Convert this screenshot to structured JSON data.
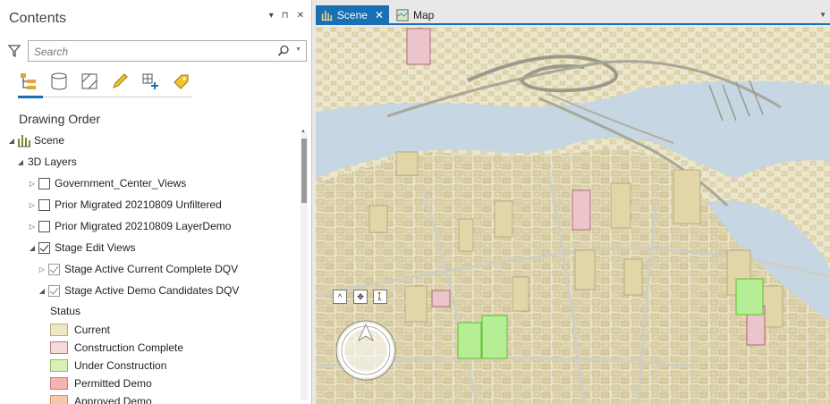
{
  "contents_pane": {
    "title": "Contents",
    "controls": [
      "▾",
      "⊓",
      "✕"
    ],
    "search_placeholder": "Search",
    "section_heading": "Drawing Order",
    "tree": [
      {
        "label": "Scene",
        "level": 0,
        "expanded": true,
        "has_checkbox": false
      },
      {
        "label": "3D Layers",
        "level": 1,
        "expanded": true,
        "has_checkbox": false
      },
      {
        "label": "Government_Center_Views",
        "level": 2,
        "expanded": false,
        "checked": false
      },
      {
        "label": "Prior Migrated 20210809 Unfiltered",
        "level": 2,
        "expanded": false,
        "checked": false
      },
      {
        "label": "Prior Migrated 20210809 LayerDemo",
        "level": 2,
        "expanded": false,
        "checked": false
      },
      {
        "label": "Stage Edit Views",
        "level": 2,
        "expanded": true,
        "checked": true
      },
      {
        "label": "Stage Active Current Complete DQV",
        "level": 3,
        "expanded": false,
        "checked": true
      },
      {
        "label": "Stage Active Demo Candidates DQV",
        "level": 3,
        "expanded": true,
        "checked": true
      }
    ],
    "legend_title": "Status",
    "legend": [
      {
        "label": "Current",
        "color": "#efe6c4",
        "border": "#b9ad7e"
      },
      {
        "label": "Construction Complete",
        "color": "#f3dcd8",
        "border": "#b07d86"
      },
      {
        "label": "Under Construction",
        "color": "#d9f0b6",
        "border": "#90c060"
      },
      {
        "label": "Permitted Demo",
        "color": "#f7b2b2",
        "border": "#d07878"
      },
      {
        "label": "Approved Demo",
        "color": "#f6c8a4",
        "border": "#d09870"
      }
    ]
  },
  "tabs": [
    {
      "label": "Scene",
      "active": true
    },
    {
      "label": "Map",
      "active": false
    }
  ],
  "scene_nav": {
    "buttons": [
      "^",
      "✥",
      "🚶"
    ]
  },
  "colors": {
    "accent": "#1a6fb5",
    "water": "#c8d8e6",
    "building": "#e8dcae"
  }
}
